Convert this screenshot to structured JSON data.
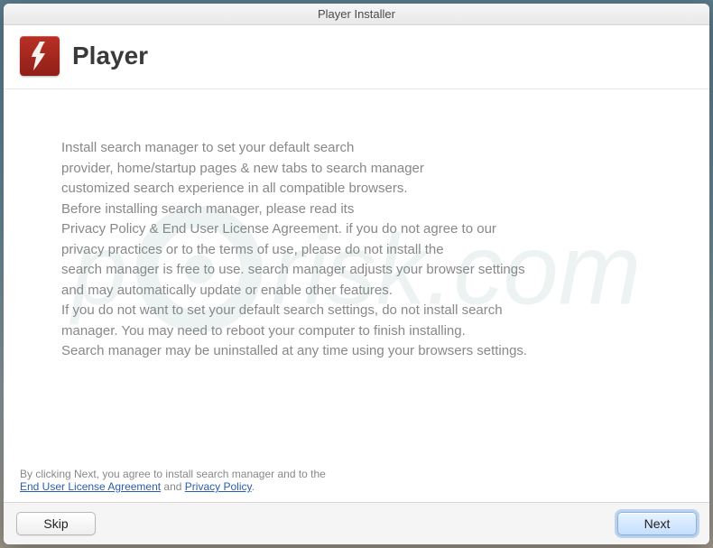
{
  "window": {
    "title": "Player Installer"
  },
  "header": {
    "app_name": "Player"
  },
  "body": {
    "text": "Install search manager to set your default search\nprovider, home/startup pages & new tabs to search manager\ncustomized search experience in all compatible browsers.\nBefore installing search manager, please read its\nPrivacy Policy & End User License Agreement. if you do not agree to our\nprivacy practices or to the terms of use, please do not install the\nsearch manager is free to use. search manager adjusts your browser settings\nand may automatically update or enable other features.\nIf you do not want to set your default search settings, do not install search\nmanager. You may need to reboot your computer to finish installing.\nSearch manager may be uninstalled at any time using your browsers settings."
  },
  "consent": {
    "prefix": "By clicking Next, you agree to install search manager and to the",
    "eula_label": "End User License Agreement",
    "and": " and ",
    "privacy_label": "Privacy Policy",
    "suffix": "."
  },
  "footer": {
    "skip_label": "Skip",
    "next_label": "Next"
  },
  "watermark": {
    "left": "p",
    "right": "risk.com"
  }
}
